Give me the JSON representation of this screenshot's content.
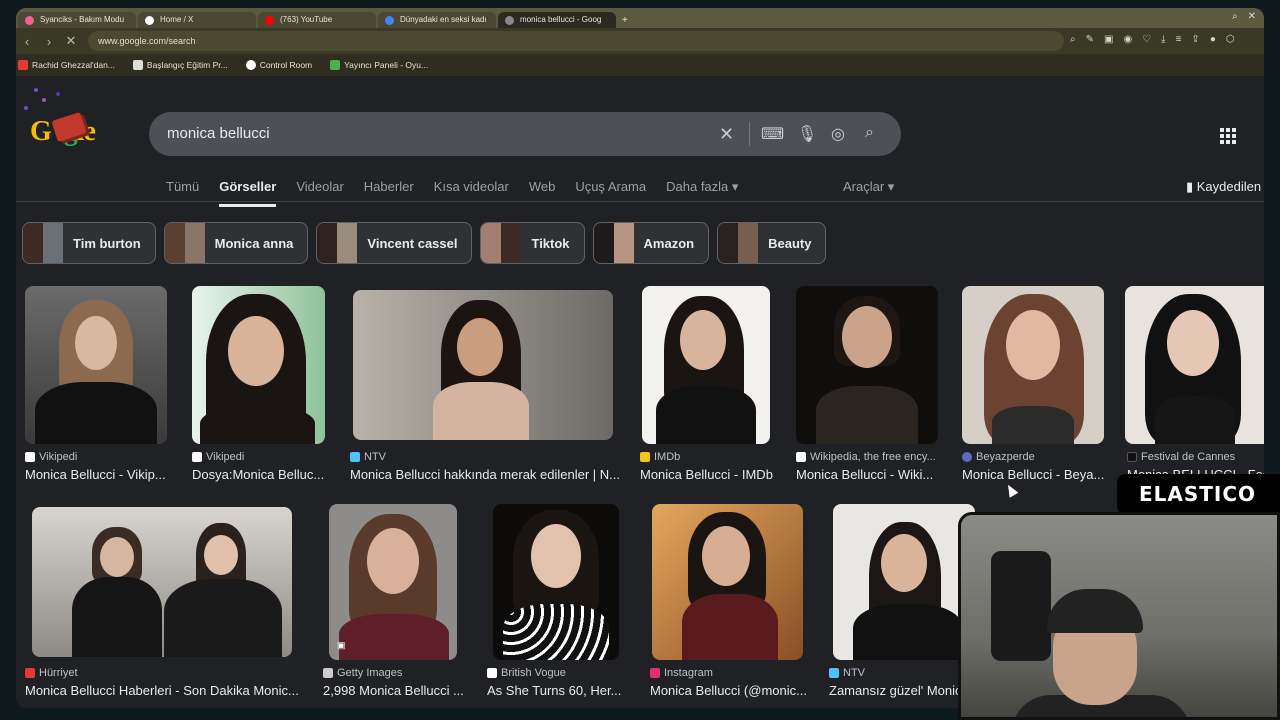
{
  "browser": {
    "tabs": [
      {
        "label": "Syanciks - Bakım Modu",
        "color": "#f06292"
      },
      {
        "label": "Home / X",
        "color": "#ffffff"
      },
      {
        "label": "(763) YouTube",
        "color": "#ff0000"
      },
      {
        "label": "Dünyadaki en seksi kadı",
        "color": "#4285f4"
      },
      {
        "label": "monica bellucci - Goog",
        "color": "#888888"
      }
    ],
    "new_tab": "+",
    "url": "www.google.com/search",
    "bookmarks": [
      {
        "label": "Rachid Ghezzal'dan...",
        "color": "#e53935"
      },
      {
        "label": "Başlangıç Eğitim Pr...",
        "color": "#dddddd"
      },
      {
        "label": "Control Room",
        "color": "#ffffff"
      },
      {
        "label": "Yayıncı Paneli - Oyu...",
        "color": "#4caf50"
      }
    ]
  },
  "search": {
    "query": "monica bellucci"
  },
  "logo_text": [
    "G",
    "o",
    "g",
    "le"
  ],
  "nav_tabs": [
    {
      "label": "Tümü"
    },
    {
      "label": "Görseller",
      "selected": true
    },
    {
      "label": "Videolar"
    },
    {
      "label": "Haberler"
    },
    {
      "label": "Kısa videolar"
    },
    {
      "label": "Web"
    },
    {
      "label": "Uçuş Arama"
    },
    {
      "label": "Daha fazla ▾"
    }
  ],
  "tools_label": "Araçlar ▾",
  "saved_label": "Kaydedilen",
  "chips": [
    {
      "label": "Tim burton"
    },
    {
      "label": "Monica anna"
    },
    {
      "label": "Vincent cassel"
    },
    {
      "label": "Tiktok"
    },
    {
      "label": "Amazon"
    },
    {
      "label": "Beauty"
    }
  ],
  "results_row1": [
    {
      "source": "Vikipedi",
      "title": "Monica Bellucci - Vikip...",
      "icon_color": "#ffffff"
    },
    {
      "source": "Vikipedi",
      "title": "Dosya:Monica Belluc...",
      "icon_color": "#ffffff"
    },
    {
      "source": "NTV",
      "title": "Monica Bellucci hakkında merak edilenler | N...",
      "icon_color": "#4fc3f7"
    },
    {
      "source": "IMDb",
      "title": "Monica Bellucci - IMDb",
      "icon_color": "#f5c518"
    },
    {
      "source": "Wikipedia, the free ency...",
      "title": "Monica Bellucci - Wiki...",
      "icon_color": "#ffffff"
    },
    {
      "source": "Beyazperde",
      "title": "Monica Bellucci - Beya...",
      "icon_color": "#5c6bc0"
    },
    {
      "source": "Festival de Cannes",
      "title": "Monica BELLUCCI - Fes",
      "icon_color": "#111111"
    }
  ],
  "results_row2": [
    {
      "source": "Hürriyet",
      "title": "Monica Bellucci Haberleri - Son Dakika Monic...",
      "icon_color": "#e53935"
    },
    {
      "source": "Getty Images",
      "title": "2,998 Monica Bellucci ...",
      "icon_color": "#cccccc"
    },
    {
      "source": "British Vogue",
      "title": "As She Turns 60, Her...",
      "icon_color": "#ffffff"
    },
    {
      "source": "Instagram",
      "title": "Monica Bellucci (@monic...",
      "icon_color": "#e1306c"
    },
    {
      "source": "NTV",
      "title": "Zamansız güzel' Monic",
      "icon_color": "#4fc3f7"
    }
  ],
  "overlay": {
    "brand": "ELASTICO"
  }
}
